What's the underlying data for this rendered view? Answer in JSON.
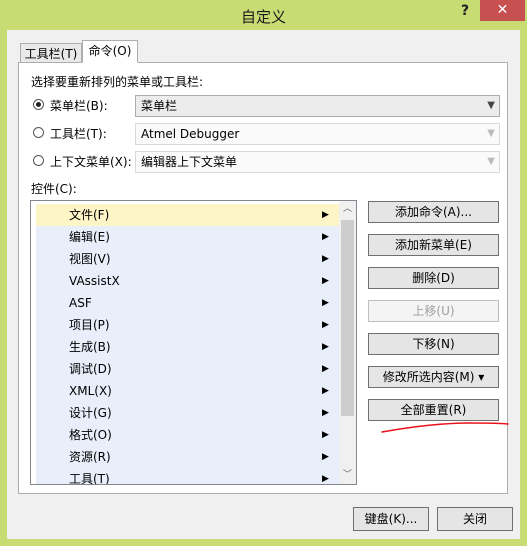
{
  "window": {
    "title": "自定义",
    "help": "?",
    "close": "✕"
  },
  "tabs": [
    {
      "label": "工具栏(T)"
    },
    {
      "label": "命令(O)"
    }
  ],
  "prompt": "选择要重新排列的菜单或工具栏:",
  "options": [
    {
      "label": "菜单栏(B):",
      "value": "菜单栏",
      "checked": true
    },
    {
      "label": "工具栏(T):",
      "value": "Atmel Debugger",
      "checked": false
    },
    {
      "label": "上下文菜单(X):",
      "value": "编辑器上下文菜单",
      "checked": false
    }
  ],
  "controls_label": "控件(C):",
  "controls": [
    "文件(F)",
    "编辑(E)",
    "视图(V)",
    "VAssistX",
    "ASF",
    "项目(P)",
    "生成(B)",
    "调试(D)",
    "XML(X)",
    "设计(G)",
    "格式(O)",
    "资源(R)",
    "工具(T)"
  ],
  "submenu_glyph": "▶",
  "actions": {
    "add_command": "添加命令(A)...",
    "add_menu": "添加新菜单(E)",
    "delete": "删除(D)",
    "move_up": "上移(U)",
    "move_down": "下移(N)",
    "modify": "修改所选内容(M) ▾",
    "reset_all": "全部重置(R)"
  },
  "footer": {
    "keyboard": "键盘(K)...",
    "close": "关闭"
  },
  "colors": {
    "title_bar": "#c9dc74",
    "close_button": "#c75050",
    "selected_row": "#fdf5c6",
    "row": "#e8eefa",
    "annotation": "#e8101a"
  }
}
